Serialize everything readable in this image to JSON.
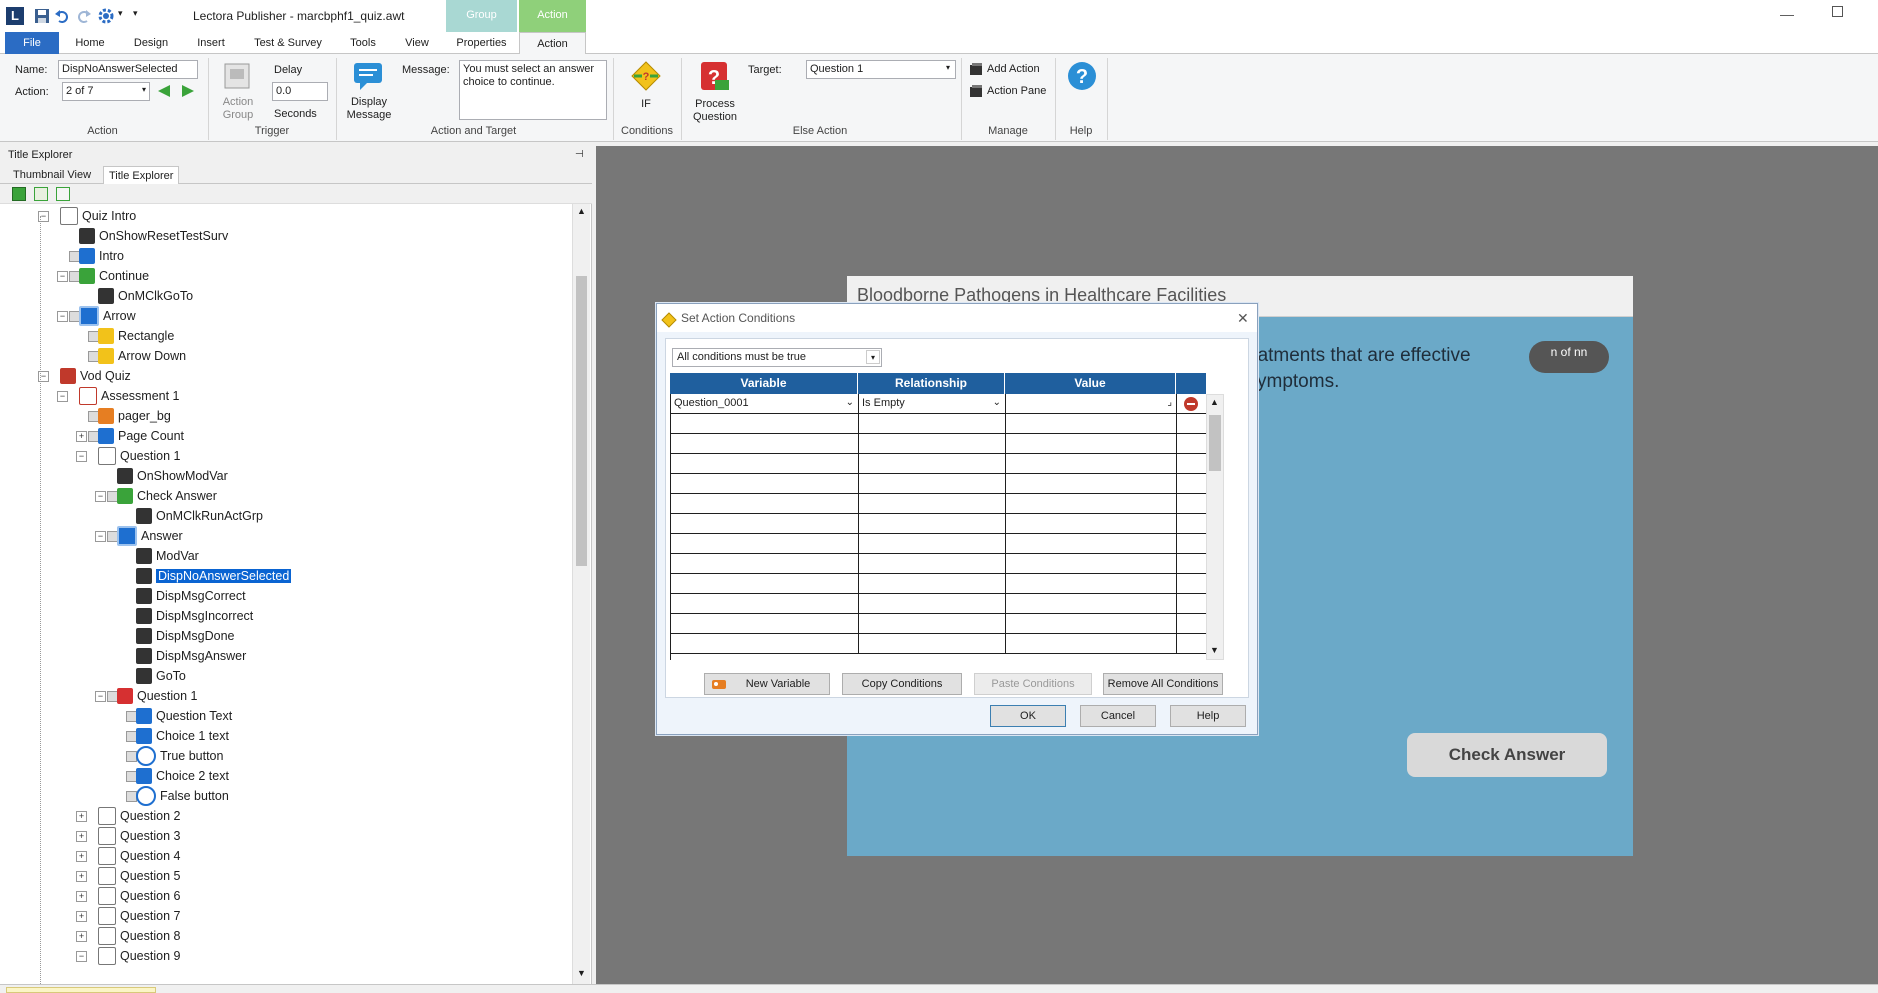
{
  "window": {
    "title": "Lectora Publisher - marcbphf1_quiz.awt",
    "context_tabs": {
      "group": "Group",
      "action": "Action"
    }
  },
  "ribbon_tabs": [
    "File",
    "Home",
    "Design",
    "Insert",
    "Test & Survey",
    "Tools",
    "View",
    "Properties",
    "Action"
  ],
  "ribbon": {
    "name_label": "Name:",
    "name_value": "DispNoAnswerSelected",
    "action_label": "Action:",
    "action_value": "2 of 7",
    "action_group_label": "Action",
    "action_group_btn": "Action",
    "action_group_btn2": "Group",
    "delay_label": "Delay",
    "delay_value": "0.0",
    "seconds_label": "Seconds",
    "trigger_label": "Trigger",
    "display_label": "Display",
    "message_btn_label": "Message",
    "message_label": "Message:",
    "message_value": "You must select an answer choice to continue.",
    "action_target_label": "Action and Target",
    "if_label": "IF",
    "conditions_label": "Conditions",
    "process_label": "Process",
    "question_label": "Question",
    "target_label": "Target:",
    "target_value": "Question 1",
    "else_action_label": "Else Action",
    "add_action": "Add Action",
    "action_pane": "Action Pane",
    "manage_label": "Manage",
    "help_label": "Help"
  },
  "left_panel": {
    "header": "Title Explorer",
    "tabs": [
      "Thumbnail View",
      "Title Explorer"
    ]
  },
  "tree": [
    {
      "label": "Quiz Intro",
      "icon": "page-icon",
      "indent": 1,
      "exp": "-"
    },
    {
      "label": "OnShowResetTestSurv",
      "icon": "action-icon",
      "indent": 2,
      "exp": ""
    },
    {
      "label": "Intro",
      "icon": "text-icon",
      "indent": 2,
      "exp": "b"
    },
    {
      "label": "Continue",
      "icon": "button-icon",
      "indent": 2,
      "exp": "-b"
    },
    {
      "label": "OnMClkGoTo",
      "icon": "action-icon",
      "indent": 3,
      "exp": ""
    },
    {
      "label": "Arrow",
      "icon": "group-icon",
      "indent": 2,
      "exp": "-b"
    },
    {
      "label": "Rectangle",
      "icon": "shape-icon",
      "indent": 3,
      "exp": "b"
    },
    {
      "label": "Arrow Down",
      "icon": "shape-icon",
      "indent": 3,
      "exp": "b"
    },
    {
      "label": "Vod Quiz",
      "icon": "test-icon",
      "indent": 1,
      "exp": "-"
    },
    {
      "label": "Assessment 1",
      "icon": "section-icon",
      "indent": 2,
      "exp": "-"
    },
    {
      "label": "pager_bg",
      "icon": "image-icon",
      "indent": 3,
      "exp": "b"
    },
    {
      "label": "Page Count",
      "icon": "text-icon",
      "indent": 3,
      "exp": "+b"
    },
    {
      "label": "Question 1",
      "icon": "page-icon",
      "indent": 3,
      "exp": "-"
    },
    {
      "label": "OnShowModVar",
      "icon": "action-icon",
      "indent": 4,
      "exp": ""
    },
    {
      "label": "Check Answer",
      "icon": "button-icon",
      "indent": 4,
      "exp": "-b"
    },
    {
      "label": "OnMClkRunActGrp",
      "icon": "action-icon",
      "indent": 5,
      "exp": ""
    },
    {
      "label": "Answer",
      "icon": "group-icon",
      "indent": 4,
      "exp": "-b"
    },
    {
      "label": "ModVar",
      "icon": "action-icon",
      "indent": 5,
      "exp": ""
    },
    {
      "label": "DispNoAnswerSelected",
      "icon": "action-icon",
      "indent": 5,
      "exp": "",
      "selected": true
    },
    {
      "label": "DispMsgCorrect",
      "icon": "action-icon",
      "indent": 5,
      "exp": ""
    },
    {
      "label": "DispMsgIncorrect",
      "icon": "action-icon",
      "indent": 5,
      "exp": ""
    },
    {
      "label": "DispMsgDone",
      "icon": "action-icon",
      "indent": 5,
      "exp": ""
    },
    {
      "label": "DispMsgAnswer",
      "icon": "action-icon",
      "indent": 5,
      "exp": ""
    },
    {
      "label": "GoTo",
      "icon": "action-icon",
      "indent": 5,
      "exp": ""
    },
    {
      "label": "Question 1",
      "icon": "question-icon",
      "indent": 4,
      "exp": "-b"
    },
    {
      "label": "Question Text",
      "icon": "text-icon",
      "indent": 5,
      "exp": "b"
    },
    {
      "label": "Choice 1 text",
      "icon": "text-icon",
      "indent": 5,
      "exp": "b"
    },
    {
      "label": "True button",
      "icon": "radio-icon",
      "indent": 5,
      "exp": "b"
    },
    {
      "label": "Choice 2 text",
      "icon": "text-icon",
      "indent": 5,
      "exp": "b"
    },
    {
      "label": "False button",
      "icon": "radio-icon",
      "indent": 5,
      "exp": "b"
    },
    {
      "label": "Question 2",
      "icon": "page-icon",
      "indent": 3,
      "exp": "+"
    },
    {
      "label": "Question 3",
      "icon": "page-icon",
      "indent": 3,
      "exp": "+"
    },
    {
      "label": "Question 4",
      "icon": "page-icon",
      "indent": 3,
      "exp": "+"
    },
    {
      "label": "Question 5",
      "icon": "page-icon",
      "indent": 3,
      "exp": "+"
    },
    {
      "label": "Question 6",
      "icon": "page-icon",
      "indent": 3,
      "exp": "+"
    },
    {
      "label": "Question 7",
      "icon": "page-icon",
      "indent": 3,
      "exp": "+"
    },
    {
      "label": "Question 8",
      "icon": "page-icon",
      "indent": 3,
      "exp": "+"
    },
    {
      "label": "Question 9",
      "icon": "page-icon",
      "indent": 3,
      "exp": "-"
    }
  ],
  "stage": {
    "title": "Bloodborne Pathogens in Healthcare Facilities",
    "text_line1": "eatments that are effective",
    "text_line2": "ymptoms.",
    "pager": "n of nn",
    "check_answer": "Check Answer"
  },
  "dialog": {
    "title": "Set Action Conditions",
    "condition_mode": "All conditions must be true",
    "columns": [
      "Variable",
      "Relationship",
      "Value"
    ],
    "row_variable": "Question_0001",
    "row_relationship": "Is Empty",
    "row_value": "",
    "buttons": {
      "new_variable": "New Variable",
      "copy_conditions": "Copy Conditions",
      "paste_conditions": "Paste Conditions",
      "remove_all": "Remove All Conditions",
      "ok": "OK",
      "cancel": "Cancel",
      "help": "Help"
    }
  },
  "colors": {
    "file_tab": "#2b6cc4",
    "group_ctx": "#a9d8d3",
    "action_ctx": "#8fd07a",
    "selection": "#0a64d2",
    "grid_header": "#1f5f9e",
    "stage_body": "#6ba9c8",
    "workspace": "#777777"
  }
}
